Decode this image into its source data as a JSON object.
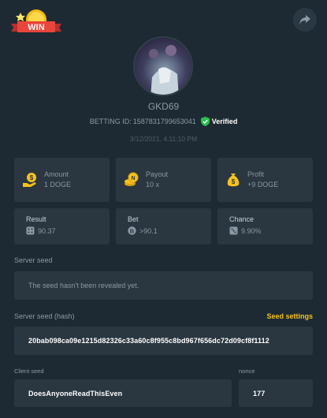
{
  "badge": {
    "label": "WIN"
  },
  "player": {
    "username": "GKD69",
    "betting_id_label": "BETTING ID:",
    "betting_id": "1587831799653041",
    "verified_label": "Verified",
    "timestamp": "3/12/2021, 4:11:10 PM"
  },
  "stats": [
    {
      "label": "Amount",
      "value": "1 DOGE",
      "icon": "coin-hand-icon"
    },
    {
      "label": "Payout",
      "value": "10 x",
      "icon": "coins-stack-icon"
    },
    {
      "label": "Profit",
      "value": "+9 DOGE",
      "icon": "money-bag-icon"
    }
  ],
  "details": [
    {
      "label": "Result",
      "value": "90.37",
      "icon": "dice-icon"
    },
    {
      "label": "Bet",
      "value": ">90.1",
      "icon": "bitcoin-icon"
    },
    {
      "label": "Chance",
      "value": "9.90%",
      "icon": "dice-icon"
    }
  ],
  "server_seed": {
    "label": "Server seed",
    "value": "The seed hasn't been revealed yet."
  },
  "server_seed_hash": {
    "label": "Server seed (hash)",
    "settings_label": "Seed settings",
    "value": "20bab098ca09e1215d82326c33a60c8f955c8bd967f656dc72d09cf8f1112"
  },
  "client_seed": {
    "label": "Client seed",
    "value": "DoesAnyoneReadThisEven"
  },
  "nonce": {
    "label": "nonce",
    "value": "177"
  },
  "colors": {
    "background": "#1e2a33",
    "card": "#2a3640",
    "accent": "#f7c21a",
    "verified": "#27c24c",
    "badge_red": "#e8453c"
  }
}
